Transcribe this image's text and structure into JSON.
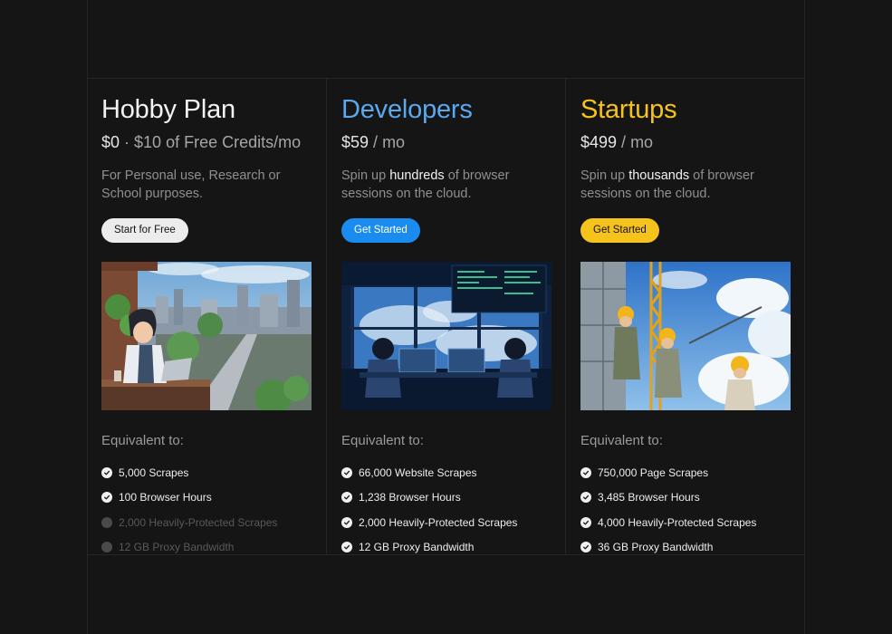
{
  "colors": {
    "background": "#151515",
    "hobby_title": "#f2f2f2",
    "developers_title": "#5ba8ef",
    "startups_title": "#f6c31c",
    "hobby_button": "#ececec",
    "developers_button": "#1a8cf0",
    "startups_button": "#f6c31c"
  },
  "plans": [
    {
      "title": "Hobby Plan",
      "price_main": "$0",
      "price_sep": " · ",
      "price_rest": "$10 of Free Credits/mo",
      "desc_before": "For Personal use, Research or School purposes.",
      "desc_highlight": "",
      "desc_after": "",
      "button_label": "Start for Free",
      "image_icon": "anime-boy-laptop-city-illustration",
      "equivalent_label": "Equivalent to:",
      "features": [
        {
          "label": "5,000 Scrapes",
          "included": true
        },
        {
          "label": "100 Browser Hours",
          "included": true
        },
        {
          "label": "2,000 Heavily-Protected Scrapes",
          "included": false
        },
        {
          "label": "12 GB Proxy Bandwidth",
          "included": false
        }
      ]
    },
    {
      "title": "Developers",
      "price_main": "$59",
      "price_sep": " / ",
      "price_rest": "mo",
      "desc_before": "Spin up ",
      "desc_highlight": "hundreds",
      "desc_after": " of browser sessions on the cloud.",
      "button_label": "Get Started",
      "image_icon": "developers-at-monitors-illustration",
      "equivalent_label": "Equivalent to:",
      "features": [
        {
          "label": "66,000 Website Scrapes",
          "included": true
        },
        {
          "label": "1,238 Browser Hours",
          "included": true
        },
        {
          "label": "2,000 Heavily-Protected Scrapes",
          "included": true
        },
        {
          "label": "12 GB Proxy Bandwidth",
          "included": true
        }
      ]
    },
    {
      "title": "Startups",
      "price_main": "$499",
      "price_sep": " / ",
      "price_rest": "mo",
      "desc_before": "Spin up ",
      "desc_highlight": "thousands",
      "desc_after": " of browser sessions on the cloud.",
      "button_label": "Get Started",
      "image_icon": "construction-workers-sky-illustration",
      "equivalent_label": "Equivalent to:",
      "features": [
        {
          "label": "750,000 Page Scrapes",
          "included": true
        },
        {
          "label": "3,485 Browser Hours",
          "included": true
        },
        {
          "label": "4,000 Heavily-Protected Scrapes",
          "included": true
        },
        {
          "label": "36 GB Proxy Bandwidth",
          "included": true
        }
      ]
    }
  ]
}
